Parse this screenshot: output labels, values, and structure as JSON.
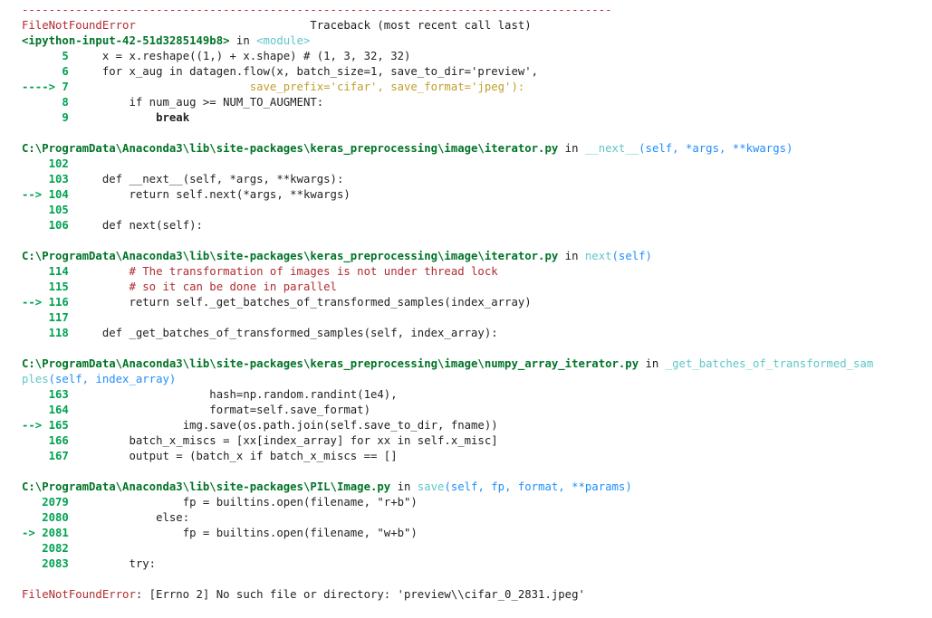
{
  "traceback": {
    "separator": "----------------------------------------------------------------------------------------",
    "header": {
      "error_name": "FileNotFoundError",
      "spacer": "                          ",
      "label": "Traceback (most recent call last)"
    },
    "frames": [
      {
        "location": [
          {
            "t": "<ipython-input-42-51d3285149b8>",
            "c": "tk-green"
          },
          {
            "t": " in ",
            "c": ""
          },
          {
            "t": "<module>",
            "c": "tk-cyan"
          }
        ],
        "lines": [
          [
            {
              "t": "      5 ",
              "c": "tk-ltgreen"
            },
            {
              "t": "    x = x.reshape((1,) + x.shape) # (1, 3, 32, 32)",
              "c": ""
            }
          ],
          [
            {
              "t": "      6 ",
              "c": "tk-ltgreen"
            },
            {
              "t": "    for x_aug in datagen.flow(x, batch_size=1, save_to_dir='preview',",
              "c": ""
            }
          ],
          [
            {
              "t": "----> 7 ",
              "c": "tk-ltgreen"
            },
            {
              "t": "                          save_prefix='cifar', save_format='jpeg'):",
              "c": "tk-str"
            }
          ],
          [
            {
              "t": "      8 ",
              "c": "tk-ltgreen"
            },
            {
              "t": "        if num_aug >= NUM_TO_AUGMENT:",
              "c": ""
            }
          ],
          [
            {
              "t": "      9 ",
              "c": "tk-ltgreen"
            },
            {
              "t": "            break",
              "c": "tk-bold"
            }
          ]
        ]
      },
      {
        "location": [
          {
            "t": "C:\\ProgramData\\Anaconda3\\lib\\site-packages\\keras_preprocessing\\image\\iterator.py",
            "c": "tk-green"
          },
          {
            "t": " in ",
            "c": ""
          },
          {
            "t": "__next__",
            "c": "tk-cyan"
          },
          {
            "t": "(self, *args, **kwargs)",
            "c": "tk-blue"
          }
        ],
        "lines": [
          [
            {
              "t": "    102 ",
              "c": "tk-ltgreen"
            },
            {
              "t": "",
              "c": ""
            }
          ],
          [
            {
              "t": "    103 ",
              "c": "tk-ltgreen"
            },
            {
              "t": "    def __next__(self, *args, **kwargs):",
              "c": ""
            }
          ],
          [
            {
              "t": "--> 104 ",
              "c": "tk-ltgreen"
            },
            {
              "t": "        return self.next(*args, **kwargs)",
              "c": ""
            }
          ],
          [
            {
              "t": "    105 ",
              "c": "tk-ltgreen"
            },
            {
              "t": "",
              "c": ""
            }
          ],
          [
            {
              "t": "    106 ",
              "c": "tk-ltgreen"
            },
            {
              "t": "    def next(self):",
              "c": ""
            }
          ]
        ]
      },
      {
        "location": [
          {
            "t": "C:\\ProgramData\\Anaconda3\\lib\\site-packages\\keras_preprocessing\\image\\iterator.py",
            "c": "tk-green"
          },
          {
            "t": " in ",
            "c": ""
          },
          {
            "t": "next",
            "c": "tk-cyan"
          },
          {
            "t": "(self)",
            "c": "tk-blue"
          }
        ],
        "lines": [
          [
            {
              "t": "    114 ",
              "c": "tk-ltgreen"
            },
            {
              "t": "        # The transformation of images is not under thread lock",
              "c": "tk-comment"
            }
          ],
          [
            {
              "t": "    115 ",
              "c": "tk-ltgreen"
            },
            {
              "t": "        # so it can be done in parallel",
              "c": "tk-comment"
            }
          ],
          [
            {
              "t": "--> 116 ",
              "c": "tk-ltgreen"
            },
            {
              "t": "        return self._get_batches_of_transformed_samples(index_array)",
              "c": ""
            }
          ],
          [
            {
              "t": "    117 ",
              "c": "tk-ltgreen"
            },
            {
              "t": "",
              "c": ""
            }
          ],
          [
            {
              "t": "    118 ",
              "c": "tk-ltgreen"
            },
            {
              "t": "    def _get_batches_of_transformed_samples(self, index_array):",
              "c": ""
            }
          ]
        ]
      },
      {
        "location": [
          {
            "t": "C:\\ProgramData\\Anaconda3\\lib\\site-packages\\keras_preprocessing\\image\\numpy_array_iterator.py",
            "c": "tk-green"
          },
          {
            "t": " in ",
            "c": ""
          },
          {
            "t": "_get_batches_of_transformed_sam",
            "c": "tk-cyan"
          }
        ],
        "location2": [
          {
            "t": "ples",
            "c": "tk-cyan"
          },
          {
            "t": "(self, index_array)",
            "c": "tk-blue"
          }
        ],
        "lines": [
          [
            {
              "t": "    163 ",
              "c": "tk-ltgreen"
            },
            {
              "t": "                    hash=np.random.randint(1e4),",
              "c": ""
            }
          ],
          [
            {
              "t": "    164 ",
              "c": "tk-ltgreen"
            },
            {
              "t": "                    format=self.save_format)",
              "c": ""
            }
          ],
          [
            {
              "t": "--> 165 ",
              "c": "tk-ltgreen"
            },
            {
              "t": "                img.save(os.path.join(self.save_to_dir, fname))",
              "c": ""
            }
          ],
          [
            {
              "t": "    166 ",
              "c": "tk-ltgreen"
            },
            {
              "t": "        batch_x_miscs = [xx[index_array] for xx in self.x_misc]",
              "c": ""
            }
          ],
          [
            {
              "t": "    167 ",
              "c": "tk-ltgreen"
            },
            {
              "t": "        output = (batch_x if batch_x_miscs == []",
              "c": ""
            }
          ]
        ]
      },
      {
        "location": [
          {
            "t": "C:\\ProgramData\\Anaconda3\\lib\\site-packages\\PIL\\Image.py",
            "c": "tk-green"
          },
          {
            "t": " in ",
            "c": ""
          },
          {
            "t": "save",
            "c": "tk-cyan"
          },
          {
            "t": "(self, fp, format, **params)",
            "c": "tk-blue"
          }
        ],
        "lines": [
          [
            {
              "t": "   2079 ",
              "c": "tk-ltgreen"
            },
            {
              "t": "                fp = builtins.open(filename, \"r+b\")",
              "c": ""
            }
          ],
          [
            {
              "t": "   2080 ",
              "c": "tk-ltgreen"
            },
            {
              "t": "            else:",
              "c": ""
            }
          ],
          [
            {
              "t": "-> 2081 ",
              "c": "tk-ltgreen"
            },
            {
              "t": "                fp = builtins.open(filename, \"w+b\")",
              "c": ""
            }
          ],
          [
            {
              "t": "   2082 ",
              "c": "tk-ltgreen"
            },
            {
              "t": "",
              "c": ""
            }
          ],
          [
            {
              "t": "   2083 ",
              "c": "tk-ltgreen"
            },
            {
              "t": "        try:",
              "c": ""
            }
          ]
        ]
      }
    ],
    "final_error": {
      "name": "FileNotFoundError",
      "message": ": [Errno 2] No such file or directory: 'preview\\\\cifar_0_2831.jpeg'"
    }
  }
}
